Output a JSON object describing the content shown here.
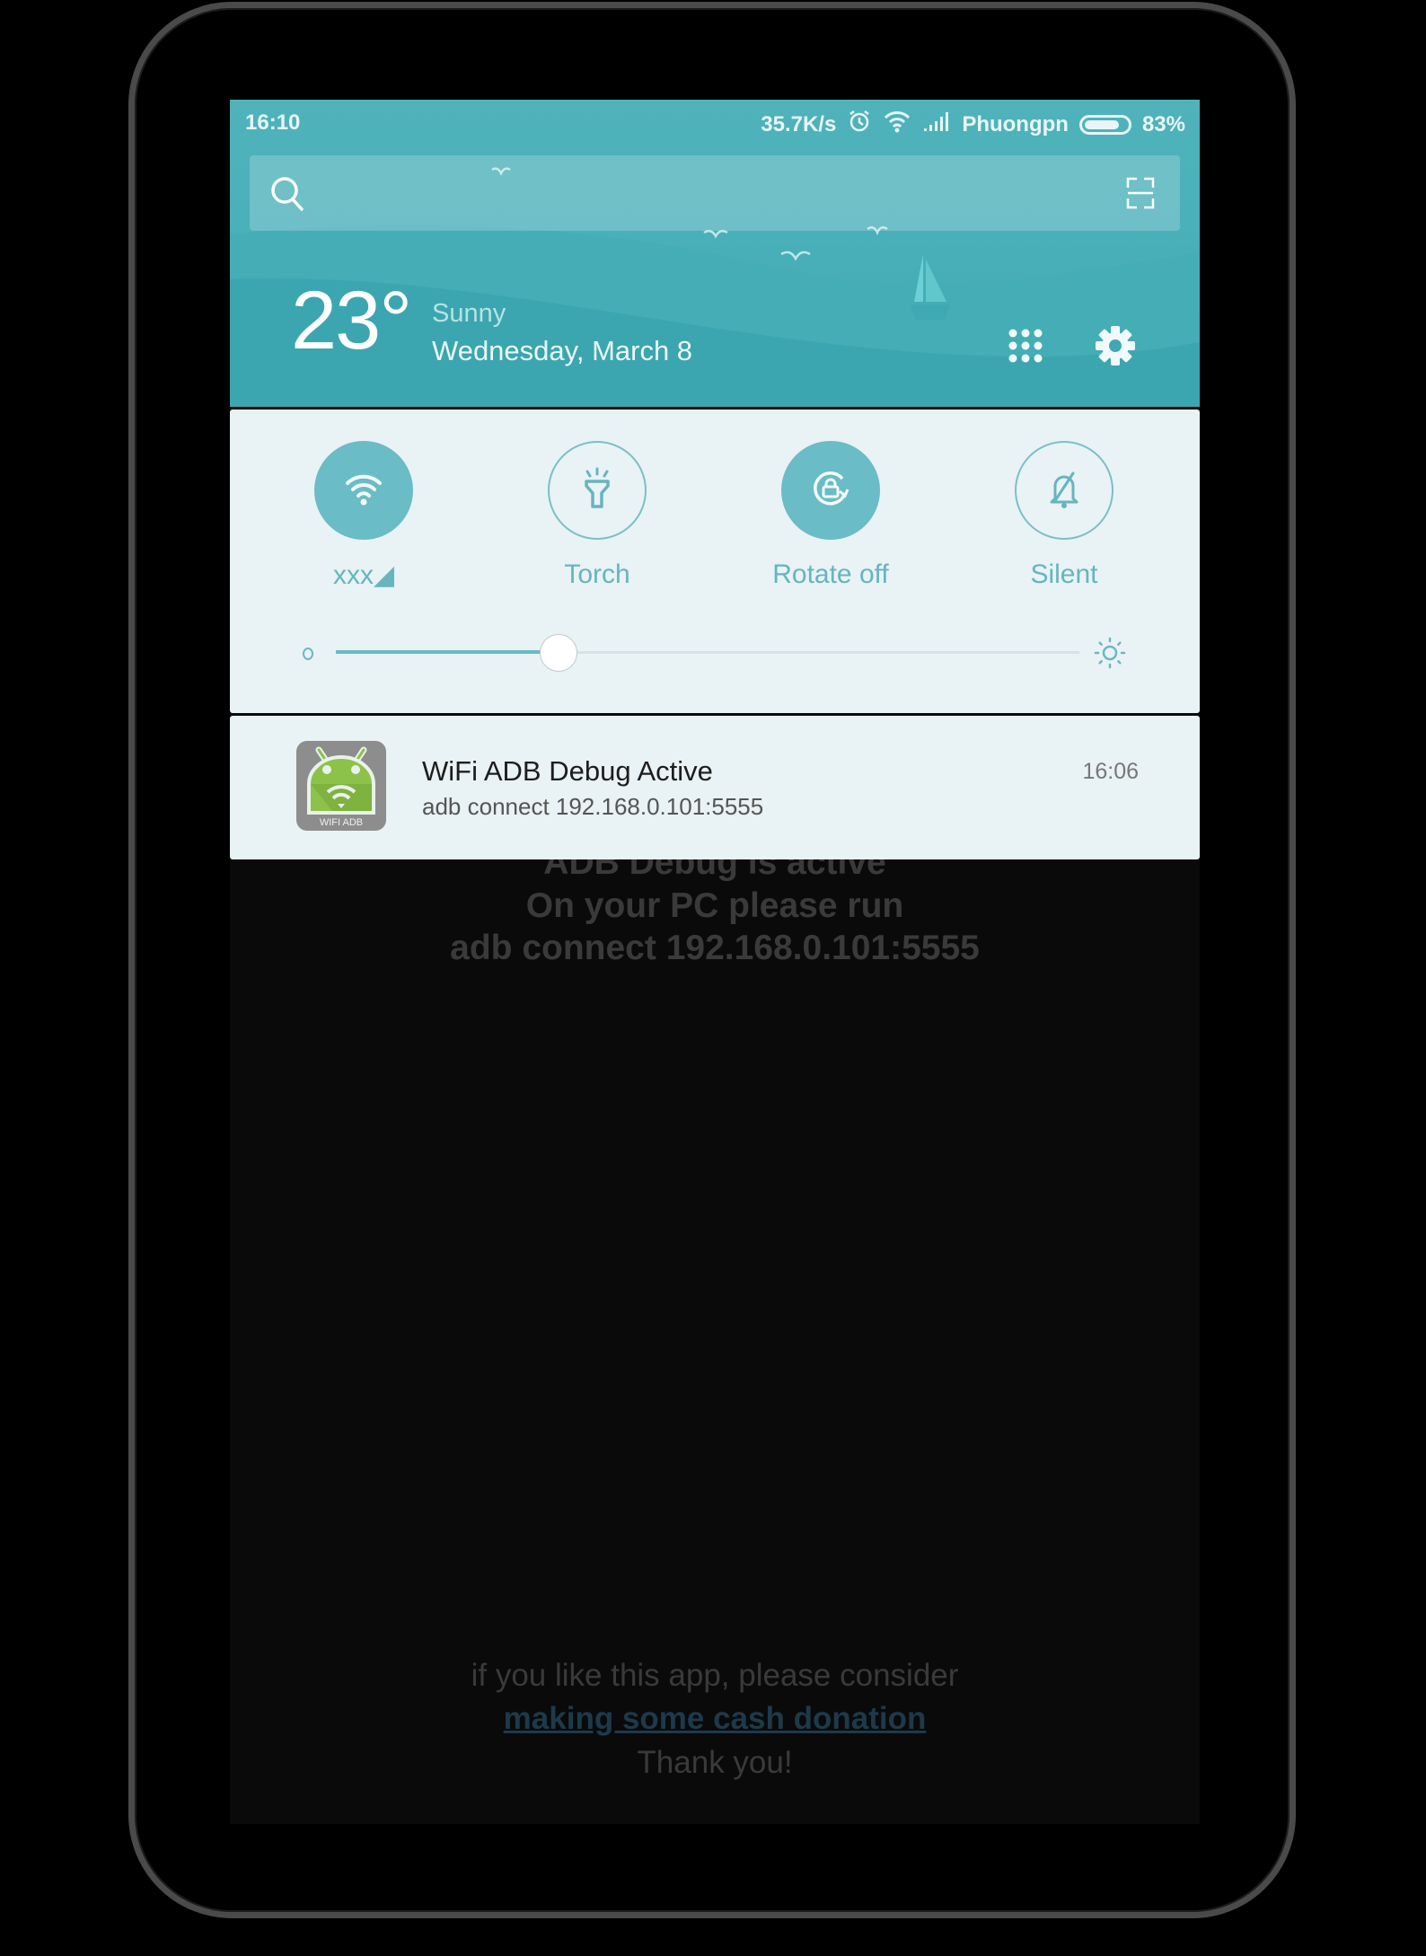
{
  "status_bar": {
    "time": "16:10",
    "network_speed": "35.7K/s",
    "carrier": "Phuongpn",
    "battery_percent": "83%",
    "battery_level": 0.83,
    "icons": [
      "alarm-icon",
      "wifi-icon",
      "signal-icon",
      "battery-icon"
    ]
  },
  "search": {
    "placeholder": "",
    "icons": [
      "search-icon",
      "scan-icon"
    ]
  },
  "weather": {
    "temperature": "23°",
    "condition": "Sunny",
    "date": "Wednesday, March 8"
  },
  "header_actions": [
    "apps-grid-icon",
    "settings-gear-icon"
  ],
  "quick_toggles": [
    {
      "label": "xxx◢",
      "icon": "wifi-icon",
      "state": "on"
    },
    {
      "label": "Torch",
      "icon": "flashlight-icon",
      "state": "off"
    },
    {
      "label": "Rotate off",
      "icon": "rotation-lock-icon",
      "state": "on"
    },
    {
      "label": "Silent",
      "icon": "bell-off-icon",
      "state": "off"
    }
  ],
  "brightness": {
    "level": 0.3,
    "icons": [
      "brightness-low-icon",
      "brightness-high-icon"
    ]
  },
  "notification": {
    "app_icon_label": "WIFI ADB",
    "title": "WiFi ADB Debug Active",
    "body": "adb connect 192.168.0.101:5555",
    "time": "16:06"
  },
  "background_app": {
    "line1": "ADB Debug is active",
    "line2": "On your PC please run",
    "line3": "adb connect 192.168.0.101:5555",
    "donate_prefix": "if you like this app, please consider",
    "donate_link": "making some cash donation",
    "thanks": "Thank you!"
  },
  "colors": {
    "accent": "#6abcc6",
    "header": "#4ab0b9",
    "panel": "#e9f2f4",
    "link": "#1d3a4a"
  }
}
